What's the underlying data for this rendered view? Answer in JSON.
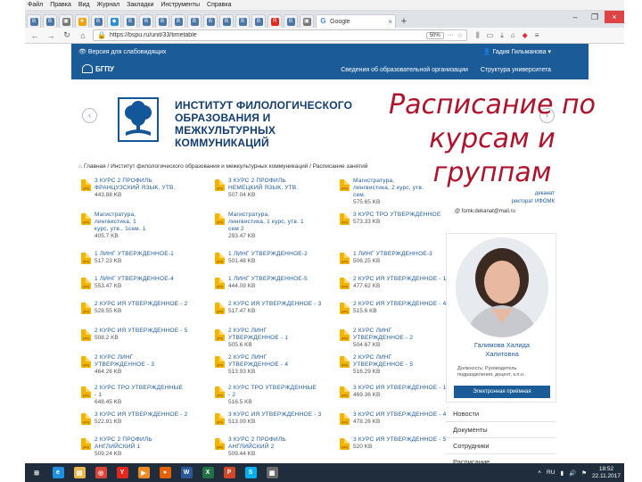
{
  "browser": {
    "menu": [
      "Файл",
      "Правка",
      "Вид",
      "Журнал",
      "Закладки",
      "Инструменты",
      "Справка"
    ],
    "tabs": [
      {
        "icon": "vk-icon",
        "glyph": "В",
        "color": "#4a76a8"
      },
      {
        "icon": "vk-icon",
        "glyph": "В",
        "color": "#4a76a8"
      },
      {
        "icon": "photo-icon",
        "glyph": "▣",
        "color": "#777777"
      },
      {
        "icon": "star-icon",
        "glyph": "★",
        "color": "#f0a30a"
      },
      {
        "icon": "vk-icon",
        "glyph": "В",
        "color": "#4a76a8"
      },
      {
        "icon": "bird-icon",
        "glyph": "◆",
        "color": "#2a8fd6"
      },
      {
        "icon": "vk-icon",
        "glyph": "В",
        "color": "#4a76a8"
      },
      {
        "icon": "vk-icon",
        "glyph": "В",
        "color": "#4a76a8"
      },
      {
        "icon": "vk-icon",
        "glyph": "В",
        "color": "#4a76a8"
      },
      {
        "icon": "vk-icon",
        "glyph": "В",
        "color": "#4a76a8"
      },
      {
        "icon": "vk-icon",
        "glyph": "В",
        "color": "#4a76a8"
      },
      {
        "icon": "vk-icon",
        "glyph": "В",
        "color": "#4a76a8"
      },
      {
        "icon": "vk-icon",
        "glyph": "В",
        "color": "#4a76a8"
      },
      {
        "icon": "vk-icon",
        "glyph": "В",
        "color": "#4a76a8"
      },
      {
        "icon": "vk-icon",
        "glyph": "В",
        "color": "#4a76a8"
      },
      {
        "icon": "yandex-icon",
        "glyph": "Я",
        "color": "#e52620"
      },
      {
        "icon": "vk-icon",
        "glyph": "В",
        "color": "#4a76a8"
      },
      {
        "icon": "photo-icon",
        "glyph": "▣",
        "color": "#777777"
      }
    ],
    "active_tab": {
      "title": "Google",
      "icon": "google-icon"
    },
    "url": "https://bspu.ru/unit/33/timetable",
    "zoom": "50%",
    "accent": "#e04343"
  },
  "site": {
    "version_link": "Версия для слабовидящих",
    "user_name": "Гадия Гильманова",
    "logo_text": "БГПУ",
    "nav_links": [
      "Сведения об образовательной организации",
      "Структура университета"
    ],
    "institute_name": "ИНСТИТУТ ФИЛОЛОГИЧЕСКОГО ОБРАЗОВАНИЯ И МЕЖКУЛЬТУРНЫХ КОММУНИКАЦИЙ",
    "overlay_title": "Расписание по курсам и группам",
    "breadcrumb": "Главная / Институт филологического образования и межкультурных коммуникаций / Расписание занятий",
    "brand_color": "#1a5b98"
  },
  "files": [
    {
      "name": "3 КУРС 2 ПРОФИЛЬ\nФРАНЦУЗСКИЙ ЯЗЫК, УТВ.",
      "size": "443.88 KB"
    },
    {
      "name": "3 КУРС 2 ПРОФИЛЬ\nНЕМЕЦКИЙ ЯЗЫК, УТВ.",
      "size": "507.04 KB"
    },
    {
      "name": "Магистратура,\nлингвистика, 2 курс, утв.\nсем.",
      "size": "575.65 KB"
    },
    {
      "name": "Магистратура,\nлингвистика, 1\nкурс, утв., 1сем. 1",
      "size": "405.7 KB"
    },
    {
      "name": "Магистратура,\nлингвистика, 1 курс, утв. 1\nсем 2",
      "size": "293.47 KB"
    },
    {
      "name": "3 КУРС ТРО УТВЕРЖДЕННОЕ",
      "size": "573.33 KB"
    },
    {
      "name": "1 ЛИНГ УТВЕРЖДЕННОЕ-1",
      "size": "517.23 KB"
    },
    {
      "name": "1 ЛИНГ УТВЕРЖДЕННОЕ-2",
      "size": "501.48 KB"
    },
    {
      "name": "1 ЛИНГ УТВЕРЖДЕННОЕ-3",
      "size": "506.25 KB"
    },
    {
      "name": "1 ЛИНГ УТВЕРЖДЕННОЕ-4",
      "size": "553.47 KB"
    },
    {
      "name": "1 ЛИНГ УТВЕРЖДЕННОЕ-5",
      "size": "444.09 KB"
    },
    {
      "name": "2 КУРС ИЯ УТВЕРЖДЕННОЕ - 1",
      "size": "477.62 KB"
    },
    {
      "name": "2 КУРС ИЯ УТВЕРЖДЕННОЕ - 2",
      "size": "528.55 KB"
    },
    {
      "name": "2 КУРС ИЯ УТВЕРЖДЕННОЕ - 3",
      "size": "517.47 KB"
    },
    {
      "name": "2 КУРС ИЯ УТВЕРЖДЕННОЕ - 4",
      "size": "515.6 KB"
    },
    {
      "name": "2 КУРС ИЯ УТВЕРЖДЕННОЕ - 5",
      "size": "508.2 KB"
    },
    {
      "name": "2 КУРС ЛИНГ\nУТВЕРЖДЕННОЕ - 1",
      "size": "505.6 KB"
    },
    {
      "name": "2 КУРС ЛИНГ\nУТВЕРЖДЕННОЕ - 2",
      "size": "504.67 KB"
    },
    {
      "name": "2 КУРС ЛИНГ\nУТВЕРЖДЕННОЕ - 3",
      "size": "464.26 KB"
    },
    {
      "name": "2 КУРС ЛИНГ\nУТВЕРЖДЕННОЕ - 4",
      "size": "513.93 KB"
    },
    {
      "name": "2 КУРС ЛИНГ\nУТВЕРЖДЕННОЕ - 5",
      "size": "516.29 KB"
    },
    {
      "name": "2 КУРС ТРО УТВЕРЖДЕННЫЕ\n- 1",
      "size": "648.45 KB"
    },
    {
      "name": "2 КУРС ТРО УТВЕРЖДЕННЫЕ\n- 2",
      "size": "516.5 KB"
    },
    {
      "name": "3 КУРС ИЯ УТВЕРЖДЕННОЕ - 1",
      "size": "469.36 KB"
    },
    {
      "name": "3 КУРС ИЯ УТВЕРЖДЕННОЕ - 2",
      "size": "522.91 KB"
    },
    {
      "name": "3 КУРС ИЯ УТВЕРЖДЕННОЕ - 3",
      "size": "513.09 KB"
    },
    {
      "name": "3 КУРС ИЯ УТВЕРЖДЕННОЕ - 4",
      "size": "478.26 KB"
    },
    {
      "name": "2 КУРС 2 ПРОФИЛЬ\nАНГЛИЙСКИЙ 1",
      "size": "509.24 KB"
    },
    {
      "name": "3 КУРС 2 ПРОФИЛЬ\nАНГЛИЙСКИЙ 2",
      "size": "509.44 KB"
    },
    {
      "name": "3 КУРС ИЯ УТВЕРЖДЕННОЕ - 5",
      "size": "520 KB"
    }
  ],
  "sidebar": {
    "contact_line1": "деканат",
    "contact_line2": "ректорат ИФОМК",
    "email": "@ fomk.dekanat@mail.ru",
    "person_name": "Галимова Халида\nХалитовна",
    "person_position": "Должность: Руководитель подразделения, доцент, к.п.н.",
    "person_button": "Электронная приёмная",
    "menu": [
      "Новости",
      "Документы",
      "Сотрудники",
      "Расписание"
    ]
  },
  "taskbar": {
    "apps": [
      {
        "icon": "windows-start-icon",
        "glyph": "⊞",
        "color": "#1f2d3d"
      },
      {
        "icon": "ie-icon",
        "glyph": "e",
        "color": "#1e8fe1"
      },
      {
        "icon": "folder-icon",
        "glyph": "▤",
        "color": "#e8b64c"
      },
      {
        "icon": "chrome-icon",
        "glyph": "◎",
        "color": "#db4437"
      },
      {
        "icon": "yandex-icon",
        "glyph": "Y",
        "color": "#e52620"
      },
      {
        "icon": "media-icon",
        "glyph": "▶",
        "color": "#f08a24"
      },
      {
        "icon": "firefox-icon",
        "glyph": "●",
        "color": "#e66000"
      },
      {
        "icon": "word-icon",
        "glyph": "W",
        "color": "#2b579a"
      },
      {
        "icon": "excel-icon",
        "glyph": "X",
        "color": "#217346"
      },
      {
        "icon": "powerpoint-icon",
        "glyph": "P",
        "color": "#d24726"
      },
      {
        "icon": "skype-icon",
        "glyph": "S",
        "color": "#00aff0"
      },
      {
        "icon": "app-icon",
        "glyph": "▦",
        "color": "#6a6a6a"
      }
    ],
    "language": "RU",
    "time": "18:52",
    "date": "22.11.2017"
  }
}
